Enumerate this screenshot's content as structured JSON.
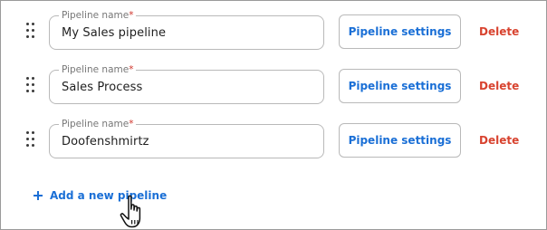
{
  "pipelines": [
    {
      "field_label": "Pipeline name",
      "required_mark": "*",
      "value": "My Sales pipeline",
      "settings_label": "Pipeline settings",
      "delete_label": "Delete"
    },
    {
      "field_label": "Pipeline name",
      "required_mark": "*",
      "value": "Sales Process",
      "settings_label": "Pipeline settings",
      "delete_label": "Delete"
    },
    {
      "field_label": "Pipeline name",
      "required_mark": "*",
      "value": "Doofenshmirtz",
      "settings_label": "Pipeline settings",
      "delete_label": "Delete"
    }
  ],
  "add_pipeline": {
    "label": "Add a new pipeline",
    "icon": "plus-icon"
  },
  "cursor": {
    "icon": "hand-pointer-icon"
  },
  "colors": {
    "accent": "#1a6fd6",
    "danger": "#d8432f",
    "required": "#d0362d",
    "border": "#b9b9b9"
  }
}
